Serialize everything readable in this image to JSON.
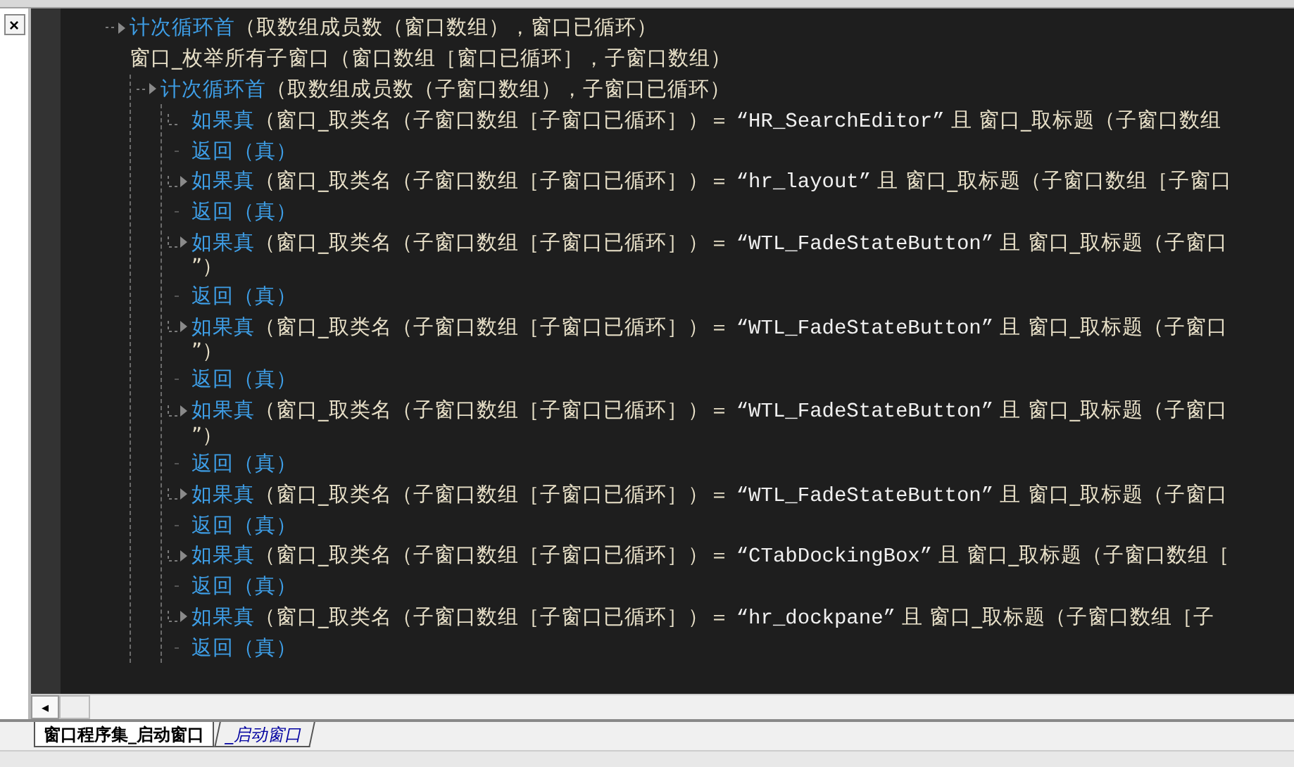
{
  "side_panel": {
    "close": "×"
  },
  "code": [
    {
      "kind": "loop",
      "arrow": true,
      "segments": [
        {
          "kind": "keyword",
          "text": "计次循环首"
        },
        {
          "kind": "plain",
          "text": "（取数组成员数（窗口数组），窗口已循环）"
        }
      ]
    },
    {
      "kind": "call",
      "arrow": false,
      "segments": [
        {
          "kind": "plain",
          "text": "窗口_枚举所有子窗口（窗口数组［窗口已循环］，子窗口数组）"
        }
      ],
      "children": [
        {
          "kind": "loop",
          "arrow": true,
          "segments": [
            {
              "kind": "keyword",
              "text": "计次循环首"
            },
            {
              "kind": "plain",
              "text": "（取数组成员数（子窗口数组），子窗口已循环）"
            }
          ],
          "children": [
            {
              "kind": "if",
              "arrow": false,
              "segments": [
                {
                  "kind": "keyword",
                  "text": "如果真"
                },
                {
                  "kind": "plain",
                  "text": "（窗口_取类名（子窗口数组［子窗口已循环］）＝ "
                },
                {
                  "kind": "string",
                  "text": "“HR_SearchEditor”"
                },
                {
                  "kind": "plain",
                  "text": " 且 窗口_取标题（子窗口数组"
                }
              ]
            },
            {
              "kind": "return",
              "arrow": false,
              "segments": [
                {
                  "kind": "keyword",
                  "text": "返回"
                },
                {
                  "kind": "keyword",
                  "text": "（真）"
                }
              ]
            },
            {
              "kind": "if",
              "arrow": true,
              "segments": [
                {
                  "kind": "keyword",
                  "text": "如果真"
                },
                {
                  "kind": "plain",
                  "text": "（窗口_取类名（子窗口数组［子窗口已循环］）＝ "
                },
                {
                  "kind": "string",
                  "text": "“hr_layout”"
                },
                {
                  "kind": "plain",
                  "text": " 且 窗口_取标题（子窗口数组［子窗口"
                }
              ]
            },
            {
              "kind": "return",
              "arrow": false,
              "segments": [
                {
                  "kind": "keyword",
                  "text": "返回"
                },
                {
                  "kind": "keyword",
                  "text": "（真）"
                }
              ]
            },
            {
              "kind": "if",
              "arrow": true,
              "segments": [
                {
                  "kind": "keyword",
                  "text": "如果真"
                },
                {
                  "kind": "plain",
                  "text": "（窗口_取类名（子窗口数组［子窗口已循环］）＝ "
                },
                {
                  "kind": "string",
                  "text": "“WTL_FadeStateButton”"
                },
                {
                  "kind": "plain",
                  "text": " 且 窗口_取标题（子窗口"
                }
              ],
              "continuation": "”）"
            },
            {
              "kind": "return",
              "arrow": false,
              "segments": [
                {
                  "kind": "keyword",
                  "text": "返回"
                },
                {
                  "kind": "keyword",
                  "text": "（真）"
                }
              ]
            },
            {
              "kind": "if",
              "arrow": true,
              "segments": [
                {
                  "kind": "keyword",
                  "text": "如果真"
                },
                {
                  "kind": "plain",
                  "text": "（窗口_取类名（子窗口数组［子窗口已循环］）＝ "
                },
                {
                  "kind": "string",
                  "text": "“WTL_FadeStateButton”"
                },
                {
                  "kind": "plain",
                  "text": " 且 窗口_取标题（子窗口"
                }
              ],
              "continuation": "”）"
            },
            {
              "kind": "return",
              "arrow": false,
              "segments": [
                {
                  "kind": "keyword",
                  "text": "返回"
                },
                {
                  "kind": "keyword",
                  "text": "（真）"
                }
              ]
            },
            {
              "kind": "if",
              "arrow": true,
              "segments": [
                {
                  "kind": "keyword",
                  "text": "如果真"
                },
                {
                  "kind": "plain",
                  "text": "（窗口_取类名（子窗口数组［子窗口已循环］）＝ "
                },
                {
                  "kind": "string",
                  "text": "“WTL_FadeStateButton”"
                },
                {
                  "kind": "plain",
                  "text": " 且 窗口_取标题（子窗口"
                }
              ],
              "continuation": "”）"
            },
            {
              "kind": "return",
              "arrow": false,
              "segments": [
                {
                  "kind": "keyword",
                  "text": "返回"
                },
                {
                  "kind": "keyword",
                  "text": "（真）"
                }
              ]
            },
            {
              "kind": "if",
              "arrow": true,
              "segments": [
                {
                  "kind": "keyword",
                  "text": "如果真"
                },
                {
                  "kind": "plain",
                  "text": "（窗口_取类名（子窗口数组［子窗口已循环］）＝ "
                },
                {
                  "kind": "string",
                  "text": "“WTL_FadeStateButton”"
                },
                {
                  "kind": "plain",
                  "text": " 且 窗口_取标题（子窗口"
                }
              ]
            },
            {
              "kind": "return",
              "arrow": false,
              "segments": [
                {
                  "kind": "keyword",
                  "text": "返回"
                },
                {
                  "kind": "keyword",
                  "text": "（真）"
                }
              ]
            },
            {
              "kind": "if",
              "arrow": true,
              "segments": [
                {
                  "kind": "keyword",
                  "text": "如果真"
                },
                {
                  "kind": "plain",
                  "text": "（窗口_取类名（子窗口数组［子窗口已循环］）＝ "
                },
                {
                  "kind": "string",
                  "text": "“CTabDockingBox”"
                },
                {
                  "kind": "plain",
                  "text": " 且 窗口_取标题（子窗口数组［"
                }
              ]
            },
            {
              "kind": "return",
              "arrow": false,
              "segments": [
                {
                  "kind": "keyword",
                  "text": "返回"
                },
                {
                  "kind": "keyword",
                  "text": "（真）"
                }
              ]
            },
            {
              "kind": "if",
              "arrow": true,
              "segments": [
                {
                  "kind": "keyword",
                  "text": "如果真"
                },
                {
                  "kind": "plain",
                  "text": "（窗口_取类名（子窗口数组［子窗口已循环］）＝ "
                },
                {
                  "kind": "string",
                  "text": "“hr_dockpane”"
                },
                {
                  "kind": "plain",
                  "text": " 且 窗口_取标题（子窗口数组［子"
                }
              ]
            },
            {
              "kind": "return",
              "arrow": false,
              "segments": [
                {
                  "kind": "keyword",
                  "text": "返回"
                },
                {
                  "kind": "keyword",
                  "text": "（真）"
                }
              ]
            }
          ]
        }
      ]
    }
  ],
  "scrollbar": {
    "left_arrow": "◂"
  },
  "tabs": [
    {
      "label": "窗口程序集_启动窗口",
      "selected": true
    },
    {
      "label": "_启动窗口",
      "selected": false
    }
  ]
}
